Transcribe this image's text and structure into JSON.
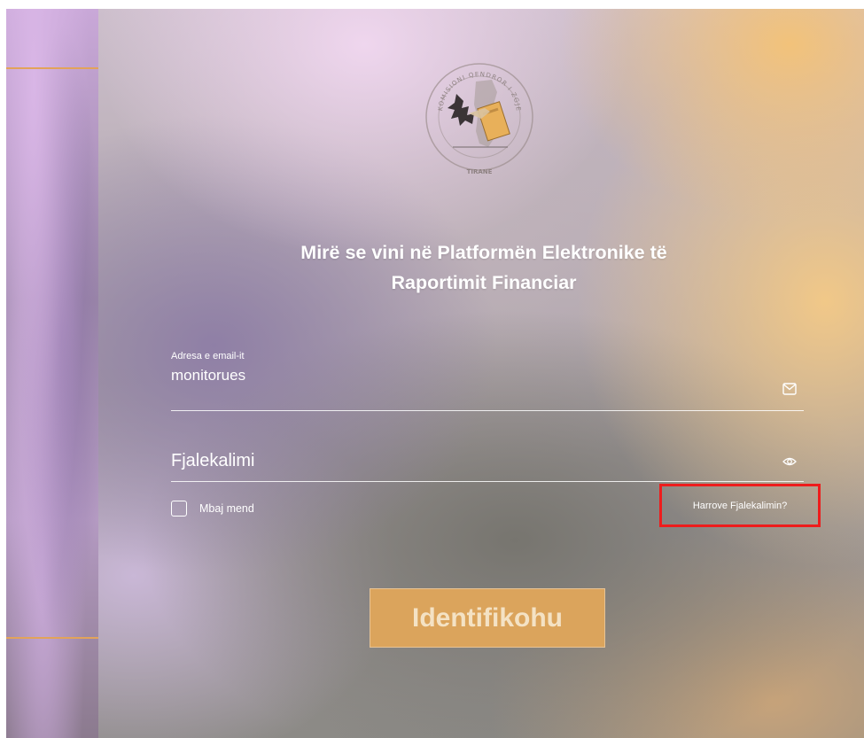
{
  "logo": {
    "ring_text_top": "KOMISIONI QENDROR I ZGJEDHJEVE",
    "ring_text_bottom": "TIRANE",
    "icon": "election-commission-seal"
  },
  "welcome": {
    "line1": "Mirë se vini në Platformën Elektronike të",
    "line2": "Raportimit Financiar"
  },
  "email_field": {
    "label": "Adresa e email-it",
    "value": "monitorues",
    "icon": "mail-icon"
  },
  "password_field": {
    "placeholder": "Fjalekalimi",
    "icon": "eye-icon"
  },
  "remember": {
    "label": "Mbaj mend",
    "checked": false
  },
  "forgot_password": {
    "label": "Harrove Fjalekalimin?",
    "highlight_color": "#ee1c1c"
  },
  "login_button": {
    "label": "Identifikohu",
    "color": "#dba45c"
  },
  "colors": {
    "accent_gold": "#e2a35a",
    "text": "#ffffff"
  }
}
